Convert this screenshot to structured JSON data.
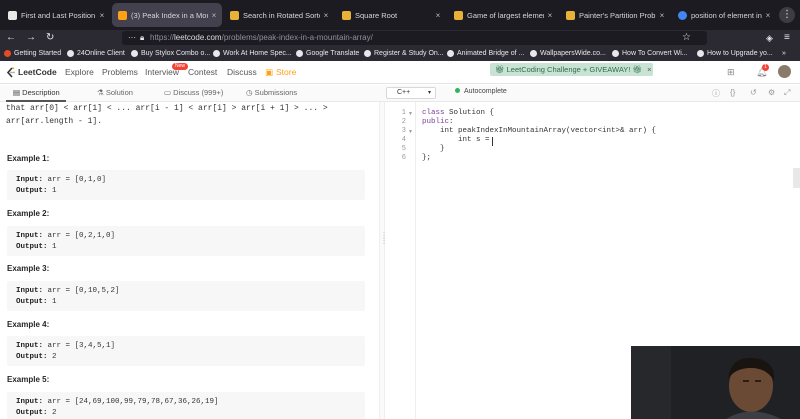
{
  "browser": {
    "tabs": [
      {
        "label": "First and Last Position of el",
        "active": false,
        "favicon_color": "#e8e8e8"
      },
      {
        "label": "(3) Peak Index in a Mountain",
        "active": true,
        "favicon_color": "#ffa116"
      },
      {
        "label": "Search in Rotated Sorted A",
        "active": false,
        "favicon_color": "#e8b23a"
      },
      {
        "label": "Square Root",
        "active": false,
        "favicon_color": "#e8b23a"
      },
      {
        "label": "Game of largest element",
        "active": false,
        "favicon_color": "#e8b23a"
      },
      {
        "label": "Painter's Partition Problem",
        "active": false,
        "favicon_color": "#e8b23a"
      },
      {
        "label": "position of element in infin",
        "active": false,
        "favicon_color": "#4285f4"
      }
    ],
    "tab_close_glyph": "×",
    "url_prefix": "https://",
    "url_domain": "leetcode.com",
    "url_path": "/problems/peak-index-in-a-mountain-array/",
    "bookmarks": [
      "Getting Started",
      "24Online Client",
      "Buy Stylox Combo o...",
      "Work At Home Spec...",
      "Google Translate",
      "Register & Study On...",
      "Animated Bridge of ...",
      "WallpapersWide.co...",
      "How To Convert Wi...",
      "How to Upgrade yo..."
    ]
  },
  "leetcode": {
    "logo": "LeetCode",
    "nav": [
      "Explore",
      "Problems",
      "Interview",
      "Contest",
      "Discuss",
      "Store"
    ],
    "new_badge": "New",
    "store_icon": "store-icon",
    "promo": "LeetCoding Challenge + GIVEAWAY!",
    "promo_close": "×",
    "notification_count": "1"
  },
  "panel_tabs": [
    "Description",
    "Solution",
    "Discuss (999+)",
    "Submissions"
  ],
  "editor_bar": {
    "language": "C++",
    "autocomplete": "Autocomplete"
  },
  "description": {
    "partial_line_1": "that arr[0] < arr[1] < ... arr[i - 1] < arr[i] > arr[i + 1] > ... >",
    "partial_line_2": "arr[arr.length - 1].",
    "examples": [
      {
        "title": "Example 1:",
        "input_label": "Input:",
        "input": " arr = [0,1,0]",
        "output_label": "Output:",
        "output": " 1"
      },
      {
        "title": "Example 2:",
        "input_label": "Input:",
        "input": " arr = [0,2,1,0]",
        "output_label": "Output:",
        "output": " 1"
      },
      {
        "title": "Example 3:",
        "input_label": "Input:",
        "input": " arr = [0,10,5,2]",
        "output_label": "Output:",
        "output": " 1"
      },
      {
        "title": "Example 4:",
        "input_label": "Input:",
        "input": " arr = [3,4,5,1]",
        "output_label": "Output:",
        "output": " 2"
      },
      {
        "title": "Example 5:",
        "input_label": "Input:",
        "input": " arr = [24,69,100,99,79,78,67,36,26,19]",
        "output_label": "Output:",
        "output": " 2"
      }
    ]
  },
  "code": {
    "lines": [
      {
        "num": "1",
        "fold": "▼",
        "kw": "class",
        "text": " Solution {"
      },
      {
        "num": "2",
        "fold": "",
        "kw": "public",
        "text": ":"
      },
      {
        "num": "3",
        "fold": "▼",
        "kw": "",
        "text": "    int peakIndexInMountainArray(vector<int>& arr) {"
      },
      {
        "num": "4",
        "fold": "",
        "kw": "",
        "text": "        int s = "
      },
      {
        "num": "5",
        "fold": "",
        "kw": "",
        "text": "    }"
      },
      {
        "num": "6",
        "fold": "",
        "kw": "",
        "text": "};"
      }
    ]
  },
  "colors": {
    "accent": "#ffa116",
    "browser_dark": "#1c1b22",
    "promo_bg": "#c8e3d4",
    "autocomplete_dot": "#2db55d"
  }
}
